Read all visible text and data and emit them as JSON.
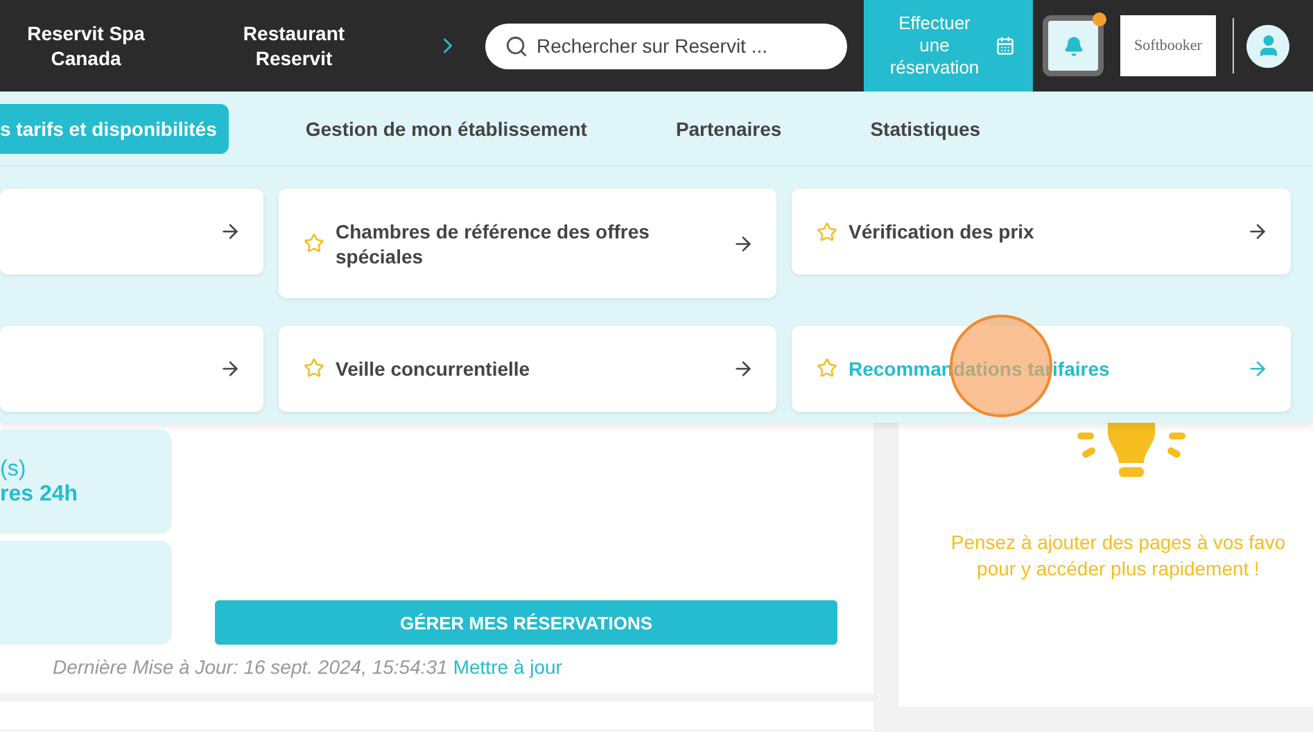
{
  "header": {
    "properties": [
      "Reservit Spa Canada",
      "Restaurant Reservit"
    ],
    "search": {
      "placeholder": "Rechercher sur Reservit ..."
    },
    "booking_button": "Effectuer une réservation",
    "notification_dot": true,
    "logo": "Softbooker"
  },
  "nav": {
    "tabs": [
      {
        "label": "s tarifs et disponibilités",
        "selected": true
      },
      {
        "label": "Gestion de mon établissement",
        "selected": false
      },
      {
        "label": "Partenaires",
        "selected": false
      },
      {
        "label": "Statistiques",
        "selected": false
      }
    ]
  },
  "menu": {
    "items": [
      {
        "active": false,
        "favorite": false
      },
      {
        "label": "Chambres de référence des offres spéciales",
        "active": false,
        "favorite": true
      },
      {
        "label": "Vérification des prix",
        "active": false,
        "favorite": true
      },
      {
        "active": false,
        "favorite": false
      },
      {
        "label": "Veille concurrentielle",
        "active": false,
        "favorite": true
      },
      {
        "label": "Recommandations tarifaires",
        "active": true,
        "favorite": true
      }
    ]
  },
  "reservations": {
    "tiles": [
      {
        "kind": "stat",
        "line_1": "(s)",
        "line_2": "res 24h"
      },
      {
        "kind": "blank"
      }
    ],
    "button": "GÉRER MES RÉSERVATIONS",
    "updated": "Dernière Mise à Jour: 16 sept. 2024, 15:54:31",
    "refresh_link": "Mettre à jour"
  },
  "favorites": {
    "hint": "Pensez à ajouter des pages à vos favo pour y accéder plus rapidement !"
  }
}
